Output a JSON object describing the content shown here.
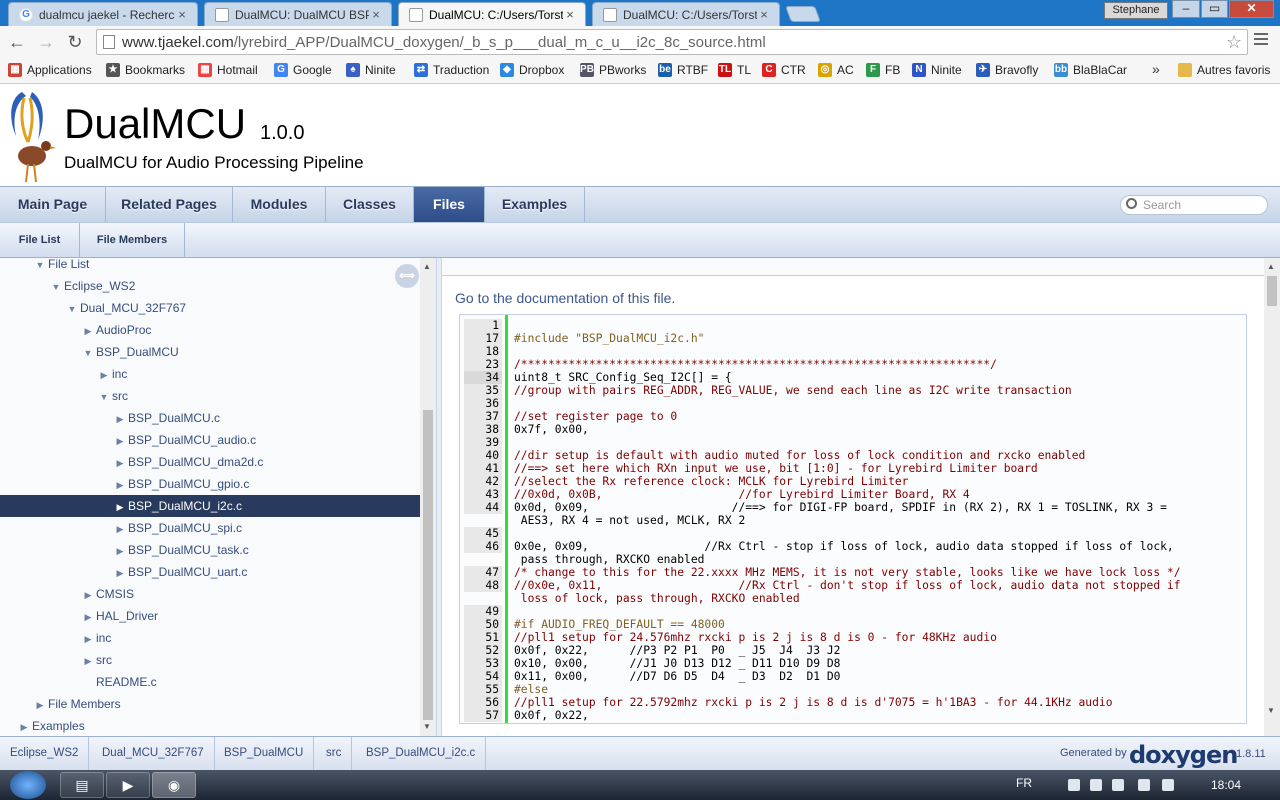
{
  "browser": {
    "tabs": [
      {
        "label": "dualmcu jaekel - Recherch",
        "icon": "google-icon"
      },
      {
        "label": "DualMCU: DualMCU BSP f",
        "icon": "document-icon"
      },
      {
        "label": "DualMCU: C:/Users/Torste",
        "icon": "document-icon",
        "active": true
      },
      {
        "label": "DualMCU: C:/Users/Torste",
        "icon": "document-icon"
      }
    ],
    "user": "Stephane",
    "url_host": "www.tjaekel.com",
    "url_path": "/lyrebird_APP/DualMCU_doxygen/_b_s_p___dual_m_c_u__i2c_8c_source.html",
    "bookmarks": [
      {
        "label": "Applications",
        "icon": "apps-grid-icon"
      },
      {
        "label": "Bookmarks",
        "icon": "star-icon"
      },
      {
        "label": "Hotmail",
        "icon": "windows-logo-icon"
      },
      {
        "label": "Google",
        "icon": "google-icon"
      },
      {
        "label": "Ninite",
        "icon": "ninite-icon"
      },
      {
        "label": "Traduction",
        "icon": "translate-icon"
      },
      {
        "label": "Dropbox",
        "icon": "dropbox-icon"
      },
      {
        "label": "PBworks",
        "icon": "pbworks-icon"
      },
      {
        "label": "RTBF",
        "icon": "rtbf-icon"
      },
      {
        "label": "TL",
        "icon": "tl-icon"
      },
      {
        "label": "CTR",
        "icon": "ctr-icon"
      },
      {
        "label": "AC",
        "icon": "ac-icon"
      },
      {
        "label": "FB",
        "icon": "fb-icon"
      },
      {
        "label": "Ninite",
        "icon": "ninite-n-icon"
      },
      {
        "label": "Bravofly",
        "icon": "bravofly-icon"
      },
      {
        "label": "BlaBlaCar",
        "icon": "blablacar-icon"
      }
    ],
    "more_bookmarks": "»",
    "other_bookmarks": "Autres favoris"
  },
  "project": {
    "name": "DualMCU",
    "number": "1.0.0",
    "brief": "DualMCU for Audio Processing Pipeline"
  },
  "main_tabs": [
    "Main Page",
    "Related Pages",
    "Modules",
    "Classes",
    "Files",
    "Examples"
  ],
  "search_placeholder": "Search",
  "sub_tabs": [
    "File List",
    "File Members"
  ],
  "tree": [
    {
      "label": "File List",
      "depth": 2,
      "arrow": "▼"
    },
    {
      "label": "Eclipse_WS2",
      "depth": 3,
      "arrow": "▼"
    },
    {
      "label": "Dual_MCU_32F767",
      "depth": 4,
      "arrow": "▼"
    },
    {
      "label": "AudioProc",
      "depth": 5,
      "arrow": "▶"
    },
    {
      "label": "BSP_DualMCU",
      "depth": 5,
      "arrow": "▼"
    },
    {
      "label": "inc",
      "depth": 6,
      "arrow": "▶"
    },
    {
      "label": "src",
      "depth": 6,
      "arrow": "▼"
    },
    {
      "label": "BSP_DualMCU.c",
      "depth": 7,
      "arrow": "▶"
    },
    {
      "label": "BSP_DualMCU_audio.c",
      "depth": 7,
      "arrow": "▶"
    },
    {
      "label": "BSP_DualMCU_dma2d.c",
      "depth": 7,
      "arrow": "▶"
    },
    {
      "label": "BSP_DualMCU_gpio.c",
      "depth": 7,
      "arrow": "▶"
    },
    {
      "label": "BSP_DualMCU_i2c.c",
      "depth": 7,
      "arrow": "▶",
      "selected": true
    },
    {
      "label": "BSP_DualMCU_spi.c",
      "depth": 7,
      "arrow": "▶"
    },
    {
      "label": "BSP_DualMCU_task.c",
      "depth": 7,
      "arrow": "▶"
    },
    {
      "label": "BSP_DualMCU_uart.c",
      "depth": 7,
      "arrow": "▶"
    },
    {
      "label": "CMSIS",
      "depth": 5,
      "arrow": "▶"
    },
    {
      "label": "HAL_Driver",
      "depth": 5,
      "arrow": "▶"
    },
    {
      "label": "inc",
      "depth": 5,
      "arrow": "▶"
    },
    {
      "label": "src",
      "depth": 5,
      "arrow": "▶"
    },
    {
      "label": "README.c",
      "depth": 5,
      "arrow": ""
    },
    {
      "label": "File Members",
      "depth": 2,
      "arrow": "▶"
    },
    {
      "label": "Examples",
      "depth": 1,
      "arrow": "▶"
    }
  ],
  "goto_doc": "Go to the documentation of this file.",
  "code": [
    {
      "n": "1",
      "t": "",
      "c": "normal"
    },
    {
      "n": "17",
      "t": "#include \"BSP_DualMCU_i2c.h\"",
      "c": "pre"
    },
    {
      "n": "18",
      "t": "",
      "c": "normal"
    },
    {
      "n": "23",
      "t": "/*********************************************************************/",
      "c": "comment"
    },
    {
      "n": "34",
      "t": "uint8_t SRC_Config_Seq_I2C[] = {",
      "c": "normal",
      "hl": true
    },
    {
      "n": "35",
      "t": "//group with pairs REG_ADDR, REG_VALUE, we send each line as I2C write transaction",
      "c": "comment"
    },
    {
      "n": "36",
      "t": "",
      "c": "normal"
    },
    {
      "n": "37",
      "t": "//set register page to 0",
      "c": "comment"
    },
    {
      "n": "38",
      "t": "0x7f, 0x00,",
      "c": "normal"
    },
    {
      "n": "39",
      "t": "",
      "c": "normal"
    },
    {
      "n": "40",
      "t": "//dir setup is default with audio muted for loss of lock condition and rxcko enabled",
      "c": "comment"
    },
    {
      "n": "41",
      "t": "//==> set here which RXn input we use, bit [1:0] - for Lyrebird Limiter board",
      "c": "comment"
    },
    {
      "n": "42",
      "t": "//select the Rx reference clock: MCLK for Lyrebird Limiter",
      "c": "comment"
    },
    {
      "n": "43",
      "t": "//0x0d, 0x0B,                    //for Lyrebird Limiter Board, RX 4",
      "c": "comment"
    },
    {
      "n": "44",
      "t": "0x0d, 0x09,                     //==> for DIGI-FP board, SPDIF in (RX 2), RX 1 = TOSLINK, RX 3 =",
      "c": "normal"
    },
    {
      "n": "",
      "t": " AES3, RX 4 = not used, MCLK, RX 2",
      "c": "normal"
    },
    {
      "n": "45",
      "t": "",
      "c": "normal"
    },
    {
      "n": "46",
      "t": "0x0e, 0x09,                 //Rx Ctrl - stop if loss of lock, audio data stopped if loss of lock,",
      "c": "normal"
    },
    {
      "n": "",
      "t": " pass through, RXCKO enabled",
      "c": "normal"
    },
    {
      "n": "47",
      "t": "/* change to this for the 22.xxxx MHz MEMS, it is not very stable, looks like we have lock loss */",
      "c": "comment"
    },
    {
      "n": "48",
      "t": "//0x0e, 0x11,                    //Rx Ctrl - don't stop if loss of lock, audio data not stopped if",
      "c": "comment"
    },
    {
      "n": "",
      "t": " loss of lock, pass through, RXCKO enabled",
      "c": "comment"
    },
    {
      "n": "49",
      "t": "",
      "c": "normal"
    },
    {
      "n": "50",
      "t": "#if AUDIO_FREQ_DEFAULT == 48000",
      "c": "pre"
    },
    {
      "n": "51",
      "t": "//pll1 setup for 24.576mhz rxcki p is 2 j is 8 d is 0 - for 48KHz audio",
      "c": "comment"
    },
    {
      "n": "52",
      "t": "0x0f, 0x22,      //P3 P2 P1  P0  _ J5  J4  J3 J2",
      "c": "normal"
    },
    {
      "n": "53",
      "t": "0x10, 0x00,      //J1 J0 D13 D12 _ D11 D10 D9 D8",
      "c": "normal"
    },
    {
      "n": "54",
      "t": "0x11, 0x00,      //D7 D6 D5  D4  _ D3  D2  D1 D0",
      "c": "normal"
    },
    {
      "n": "55",
      "t": "#else",
      "c": "pre"
    },
    {
      "n": "56",
      "t": "//pll1 setup for 22.5792mhz rxcki p is 2 j is 8 d is d'7075 = h'1BA3 - for 44.1KHz audio",
      "c": "comment"
    },
    {
      "n": "57",
      "t": "0x0f, 0x22,",
      "c": "normal"
    }
  ],
  "navpath": [
    "Eclipse_WS2",
    "Dual_MCU_32F767",
    "BSP_DualMCU",
    "src",
    "BSP_DualMCU_i2c.c"
  ],
  "footer": {
    "generated_by": "Generated by",
    "logo": "doxygen",
    "version": "1.8.11"
  },
  "taskbar": {
    "lang": "FR",
    "time": "18:04"
  }
}
